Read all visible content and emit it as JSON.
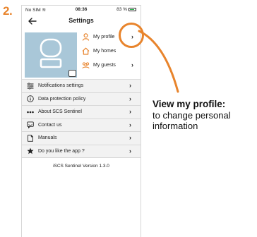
{
  "step": {
    "number": "2."
  },
  "status_bar": {
    "carrier": "No SIM",
    "time": "08:36",
    "battery": "83 %"
  },
  "header": {
    "title": "Settings"
  },
  "profile_menu": [
    {
      "label": "My profile",
      "icon": "user-icon"
    },
    {
      "label": "My homes",
      "icon": "home-icon"
    },
    {
      "label": "My guests",
      "icon": "guests-icon"
    }
  ],
  "settings": [
    {
      "label": "Notifications settings",
      "icon": "sliders-icon"
    },
    {
      "label": "Data protection policy",
      "icon": "info-icon"
    },
    {
      "label": "About SCS Sentinel",
      "icon": "dots-icon"
    },
    {
      "label": "Contact us",
      "icon": "chat-icon"
    },
    {
      "label": "Manuals",
      "icon": "document-icon"
    },
    {
      "label": "Do you like the app ?",
      "icon": "star-icon"
    }
  ],
  "version": "iSCS Sentinel Version 1.3.0",
  "callout": {
    "title": "View my profile:",
    "text": "to change personal information"
  },
  "colors": {
    "accent": "#e8842c",
    "avatar_bg": "#a9c7d8",
    "list_bg": "#f2f2f2"
  }
}
